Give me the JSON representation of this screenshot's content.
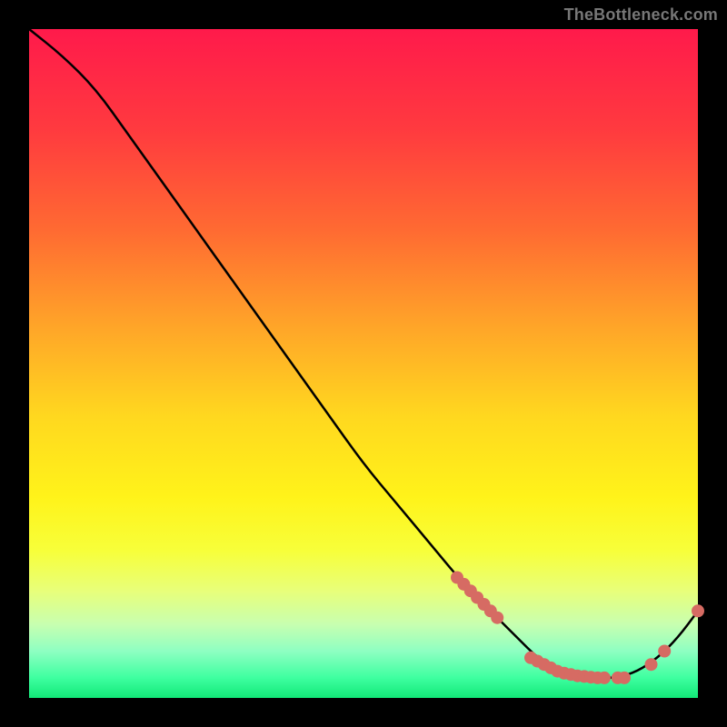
{
  "watermark": "TheBottleneck.com",
  "chart_data": {
    "type": "line",
    "title": "",
    "xlabel": "",
    "ylabel": "",
    "xlim": [
      0,
      100
    ],
    "ylim": [
      0,
      100
    ],
    "series": [
      {
        "name": "bottleneck-curve",
        "x": [
          0,
          5,
          10,
          15,
          20,
          25,
          30,
          35,
          40,
          45,
          50,
          55,
          60,
          65,
          70,
          73,
          76,
          79,
          82,
          85,
          88,
          91,
          94,
          97,
          100
        ],
        "y": [
          100,
          96,
          91,
          84,
          77,
          70,
          63,
          56,
          49,
          42,
          35,
          29,
          23,
          17,
          12,
          9,
          6,
          4,
          3,
          3,
          3,
          4,
          6,
          9,
          13
        ]
      }
    ],
    "markers": {
      "name": "highlight-points",
      "color": "#d66b63",
      "x": [
        64,
        65,
        66,
        67,
        68,
        69,
        70,
        75,
        76,
        77,
        78,
        79,
        80,
        81,
        82,
        83,
        84,
        85,
        86,
        88,
        89,
        93,
        95,
        100
      ],
      "y": [
        18,
        17,
        16,
        15,
        14,
        13,
        12,
        6,
        5.5,
        5,
        4.5,
        4,
        3.7,
        3.5,
        3.3,
        3.2,
        3.1,
        3,
        3,
        3,
        3,
        5,
        7,
        13
      ]
    }
  }
}
